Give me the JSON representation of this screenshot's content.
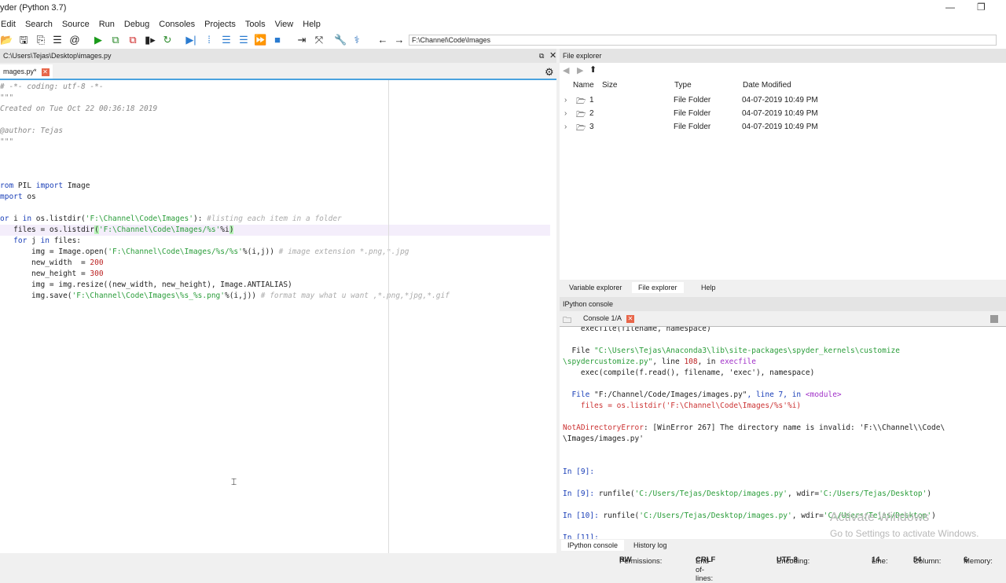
{
  "window": {
    "title": "yder (Python 3.7)"
  },
  "menu": [
    "Edit",
    "Search",
    "Source",
    "Run",
    "Debug",
    "Consoles",
    "Projects",
    "Tools",
    "View",
    "Help"
  ],
  "toolbar": {
    "path": "F:\\Channel\\Code\\Images"
  },
  "editor": {
    "path": "C:\\Users\\Tejas\\Desktop\\images.py",
    "tab": "mages.py*",
    "lines": [
      [
        [
          "d",
          "# -*- coding: utf-8 -*-"
        ]
      ],
      [
        [
          "d",
          "\"\"\""
        ]
      ],
      [
        [
          "d",
          "Created on Tue Oct 22 00:36:18 2019"
        ]
      ],
      [],
      [
        [
          "d",
          "@author: Tejas"
        ]
      ],
      [
        [
          "d",
          "\"\"\""
        ]
      ],
      [],
      [],
      [],
      [
        [
          "k",
          "rom"
        ],
        [
          "tx",
          " PIL "
        ],
        [
          "k",
          "import"
        ],
        [
          "tx",
          " Image"
        ]
      ],
      [
        [
          "k",
          "mport"
        ],
        [
          "tx",
          " os"
        ]
      ],
      [],
      [
        [
          "k",
          "or"
        ],
        [
          "tx",
          " i "
        ],
        [
          "k",
          "in"
        ],
        [
          "tx",
          " os.listdir("
        ],
        [
          "s",
          "'F:\\Channel\\Code\\Images'"
        ],
        [
          "tx",
          "): "
        ],
        [
          "c",
          "#listing each item in a folder"
        ]
      ],
      [
        [
          "tx",
          "   files = os.listdir"
        ],
        [
          "bm",
          "("
        ],
        [
          "s",
          "'F:\\Channel\\Code\\Images/%s'"
        ],
        [
          "tx",
          "%i"
        ],
        [
          "bm",
          ")"
        ]
      ],
      [
        [
          "tx",
          "   "
        ],
        [
          "k",
          "for"
        ],
        [
          "tx",
          " j "
        ],
        [
          "k",
          "in"
        ],
        [
          "tx",
          " files:"
        ]
      ],
      [
        [
          "tx",
          "       img = Image.open("
        ],
        [
          "s",
          "'F:\\Channel\\Code\\Images/%s/%s'"
        ],
        [
          "tx",
          "%(i,j)) "
        ],
        [
          "c",
          "# image extension *.png,*.jpg"
        ]
      ],
      [
        [
          "tx",
          "       new_width  = "
        ],
        [
          "n",
          "200"
        ]
      ],
      [
        [
          "tx",
          "       new_height = "
        ],
        [
          "n",
          "300"
        ]
      ],
      [
        [
          "tx",
          "       img = img.resize((new_width, new_height), Image.ANTIALIAS)"
        ]
      ],
      [
        [
          "tx",
          "       img.save("
        ],
        [
          "s",
          "'F:\\Channel\\Code\\Images\\%s_%s.png'"
        ],
        [
          "tx",
          "%(i,j)) "
        ],
        [
          "c",
          "# format may what u want ,*.png,*jpg,*.gif"
        ]
      ]
    ]
  },
  "file_explorer": {
    "title": "File explorer",
    "columns": [
      "Name",
      "Size",
      "Type",
      "Date Modified"
    ],
    "rows": [
      {
        "name": "1",
        "type": "File Folder",
        "date": "04-07-2019 10:49 PM"
      },
      {
        "name": "2",
        "type": "File Folder",
        "date": "04-07-2019 10:49 PM"
      },
      {
        "name": "3",
        "type": "File Folder",
        "date": "04-07-2019 10:49 PM"
      }
    ]
  },
  "right_tabs": [
    "Variable explorer",
    "File explorer",
    "Help"
  ],
  "ipython": {
    "title": "IPython console",
    "tab": "Console 1/A",
    "lines": [
      [
        [
          "tx",
          "    execfile(filename, namespace)"
        ]
      ],
      [],
      [
        [
          "tx",
          "  File "
        ],
        [
          "s",
          "\"C:\\Users\\Tejas\\Anaconda3\\lib\\site-packages\\spyder_kernels\\customize"
        ]
      ],
      [
        [
          "s",
          "\\spydercustomize.py\""
        ],
        [
          "tx",
          ", line "
        ],
        [
          "n",
          "108"
        ],
        [
          "tx",
          ", in "
        ],
        [
          "m",
          "execfile"
        ]
      ],
      [
        [
          "tx",
          "    exec(compile(f.read(), filename, 'exec'), namespace)"
        ]
      ],
      [],
      [
        [
          "k",
          "  File "
        ],
        [
          "tx",
          "\"F:/Channel/Code/Images/images.py\""
        ],
        [
          "k",
          ", line 7, in "
        ],
        [
          "m",
          "<module>"
        ]
      ],
      [
        [
          "r",
          "    files = os.listdir('F:\\Channel\\Code\\Images/%s'%i)"
        ]
      ],
      [],
      [
        [
          "r",
          "NotADirectoryError"
        ],
        [
          "tx",
          ": [WinError 267] The directory name is invalid: 'F:\\\\Channel\\\\Code\\"
        ]
      ],
      [
        [
          "tx",
          "\\Images/images.py'"
        ]
      ],
      [],
      [],
      [
        [
          "k",
          "In ["
        ],
        [
          "k",
          "9"
        ],
        [
          "k",
          "]:"
        ]
      ],
      [],
      [
        [
          "k",
          "In ["
        ],
        [
          "k",
          "9"
        ],
        [
          "k",
          "]: "
        ],
        [
          "tx",
          "runfile("
        ],
        [
          "s",
          "'C:/Users/Tejas/Desktop/images.py'"
        ],
        [
          "tx",
          ", wdir="
        ],
        [
          "s",
          "'C:/Users/Tejas/Desktop'"
        ],
        [
          "tx",
          ")"
        ]
      ],
      [],
      [
        [
          "k",
          "In ["
        ],
        [
          "k",
          "10"
        ],
        [
          "k",
          "]: "
        ],
        [
          "tx",
          "runfile("
        ],
        [
          "s",
          "'C:/Users/Tejas/Desktop/images.py'"
        ],
        [
          "tx",
          ", wdir="
        ],
        [
          "s",
          "'C:/Users/Tejas/Desktop'"
        ],
        [
          "tx",
          ")"
        ]
      ],
      [],
      [
        [
          "k",
          "In ["
        ],
        [
          "k",
          "11"
        ],
        [
          "k",
          "]:"
        ]
      ]
    ]
  },
  "bottom_tabs": [
    "IPython console",
    "History log"
  ],
  "watermark": {
    "line1": "Activate Windows",
    "line2": "Go to Settings to activate Windows."
  },
  "status": {
    "permissions_label": "Permissions:",
    "permissions": "RW",
    "eol_label": "End-of-lines:",
    "eol": "CRLF",
    "encoding_label": "Encoding:",
    "encoding": "UTF-8",
    "line_label": "Line:",
    "line": "14",
    "column_label": "Column:",
    "column": "54",
    "memory_label": "Memory:",
    "memory": "6"
  }
}
